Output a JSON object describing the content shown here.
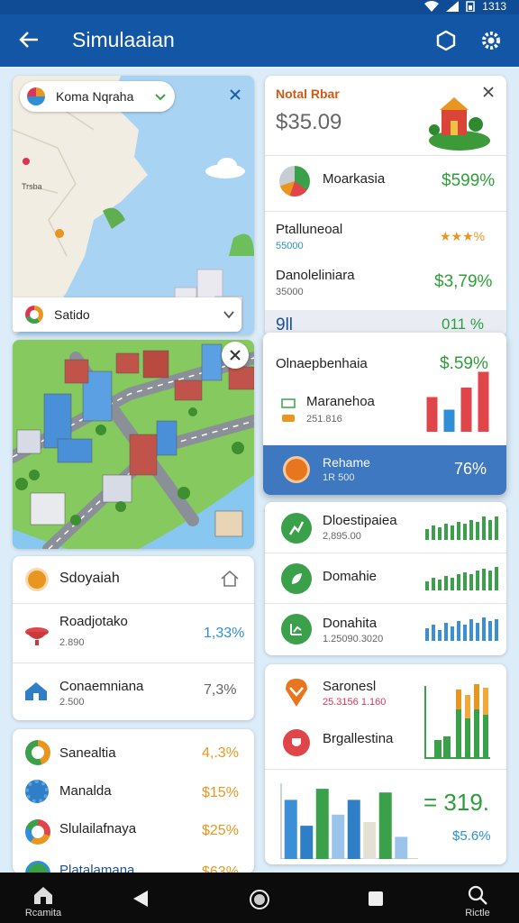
{
  "status": {
    "time": "1313"
  },
  "appbar": {
    "title": "Simulaaian",
    "back_icon": "arrow-left-icon",
    "icons": [
      "hexagon-icon",
      "gear-icon"
    ]
  },
  "map": {
    "search_chip": "Koma Nqraha",
    "region_chip": "Satido",
    "labels": [
      "Trsba"
    ]
  },
  "city": {},
  "left_card": {
    "title": "Sdoyaiah",
    "rows": [
      {
        "label": "Roadjotako",
        "sub": "2.890",
        "value": "1,33%",
        "color": "#2f8fd6"
      },
      {
        "label": "Conaemniana",
        "sub": "2.500",
        "value": "7,3%",
        "color": "#666666"
      }
    ]
  },
  "left_card2": {
    "rows": [
      {
        "label": "Sanealtia",
        "value": "4,.3%",
        "color": "#e8961f"
      },
      {
        "label": "Manalda",
        "value": "$15%",
        "color": "#e8961f"
      },
      {
        "label": "Slulailafnaya",
        "value": "$25%",
        "color": "#e8961f"
      },
      {
        "label": "Platalamana",
        "value": "$63%",
        "color": "#e8961f"
      }
    ]
  },
  "summary": {
    "title": "Notal Rbar",
    "amount": "$35.09",
    "rows": [
      {
        "label": "Moarkasia",
        "value": "$599%",
        "color": "#2e9e3a"
      },
      {
        "label": "Ptalluneoal",
        "sub": "55000",
        "value": "★★★%",
        "color": "#e8961f"
      },
      {
        "label": "Danoleliniara",
        "sub": "35000",
        "value": "$3,79%",
        "color": "#2e9e3a"
      }
    ],
    "cut_left": "9ll",
    "cut_right": "011 %"
  },
  "overlay": {
    "title": "Olnaepbenhaia",
    "value": "$.59%",
    "row_label": "Maranehoa",
    "row_sub": "251.816",
    "footer_label": "Rehame",
    "footer_sub": "1R 500",
    "footer_value": "76%"
  },
  "stats": {
    "rows": [
      {
        "label": "Dloestipaiea",
        "sub": "2,895.00",
        "bar_color": "#3aa04a"
      },
      {
        "label": "Domahie",
        "sub": "",
        "bar_color": "#3aa04a"
      },
      {
        "label": "Donahita",
        "sub": "1.25090.3020",
        "bar_color": "#3b8fd6"
      }
    ]
  },
  "chart_card": {
    "row1": {
      "label": "Saronesl",
      "sub": "25.3156 1.160"
    },
    "row2": {
      "label": "Brgallestina"
    },
    "big_value": "= 319.",
    "sub_value": "$5.6%"
  },
  "chart_data": [
    {
      "type": "bar",
      "series": [
        {
          "values": [
            55,
            35,
            70,
            95
          ]
        }
      ]
    },
    {
      "type": "bar",
      "series": [
        {
          "values": [
            80,
            45,
            95,
            60,
            80,
            50,
            90,
            30
          ]
        }
      ]
    }
  ],
  "navbar": {
    "home": "Rcamita",
    "search": "Rictle"
  },
  "colors": {
    "appbar": "#1356a6",
    "green": "#2e9e3a",
    "orange": "#e8961f",
    "blue": "#2f8fd6",
    "red": "#e0454a"
  }
}
